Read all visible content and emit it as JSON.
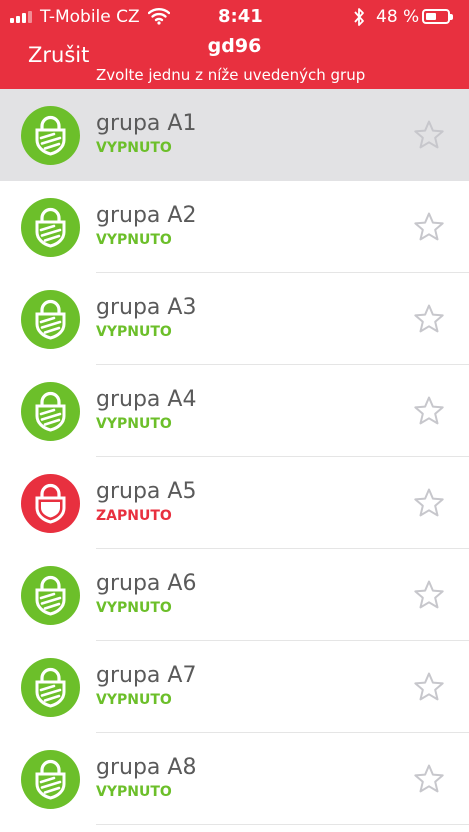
{
  "status_bar": {
    "carrier": "T-Mobile CZ",
    "time": "8:41",
    "battery_text": "48 %",
    "battery_level": 0.48
  },
  "header": {
    "cancel_label": "Zrušit",
    "title": "gd96",
    "subtitle": "Zvolte jednu z níže uvedených grup"
  },
  "colors": {
    "header_bg": "#e8303f",
    "off": "#6cbf2a",
    "on": "#e8303f",
    "star": "#c7c7cc",
    "selected_row_bg": "#e2e2e4"
  },
  "groups": [
    {
      "name": "grupa A1",
      "state": "VYPNUTO",
      "status": "off",
      "selected": true,
      "icon": "shield-lock-icon"
    },
    {
      "name": "grupa A2",
      "state": "VYPNUTO",
      "status": "off",
      "selected": false,
      "icon": "shield-lock-icon"
    },
    {
      "name": "grupa A3",
      "state": "VYPNUTO",
      "status": "off",
      "selected": false,
      "icon": "shield-lock-icon"
    },
    {
      "name": "grupa A4",
      "state": "VYPNUTO",
      "status": "off",
      "selected": false,
      "icon": "shield-lock-icon"
    },
    {
      "name": "grupa A5",
      "state": "ZAPNUTO",
      "status": "on",
      "selected": false,
      "icon": "lock-icon"
    },
    {
      "name": "grupa A6",
      "state": "VYPNUTO",
      "status": "off",
      "selected": false,
      "icon": "shield-lock-icon"
    },
    {
      "name": "grupa A7",
      "state": "VYPNUTO",
      "status": "off",
      "selected": false,
      "icon": "shield-lock-icon"
    },
    {
      "name": "grupa A8",
      "state": "VYPNUTO",
      "status": "off",
      "selected": false,
      "icon": "shield-lock-icon"
    }
  ]
}
